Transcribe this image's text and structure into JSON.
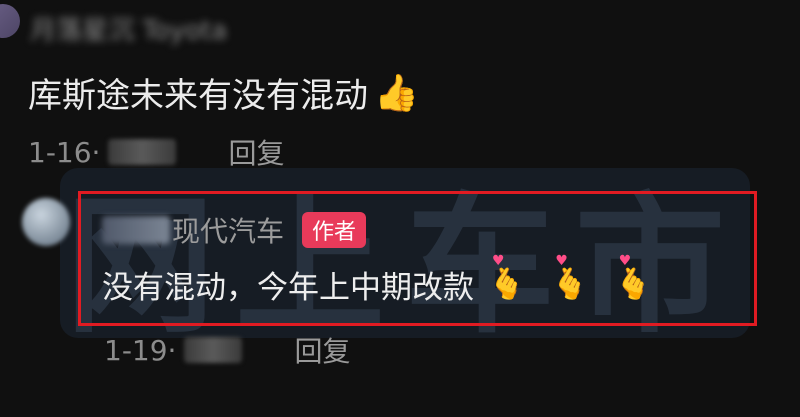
{
  "watermark": {
    "text": "网上车市"
  },
  "top_comment": {
    "username": "月落星沉 Toyota",
    "text": "库斯途未来有没有混动",
    "emoji_icon": "thumbs-up-icon",
    "emoji_glyph": "👍",
    "date": "1-16",
    "dot": "·",
    "reply_label": "回复"
  },
  "author_reply": {
    "username": "现代汽车",
    "badge": "作者",
    "badge_color": "#e83a5a",
    "text": "没有混动，今年上中期改款",
    "emoji_icon": "finger-heart-icon",
    "emoji_glyph": "🫰",
    "emoji_count": 3,
    "date": "1-19",
    "dot": "·",
    "reply_label": "回复",
    "highlight_color": "#e11b22"
  }
}
